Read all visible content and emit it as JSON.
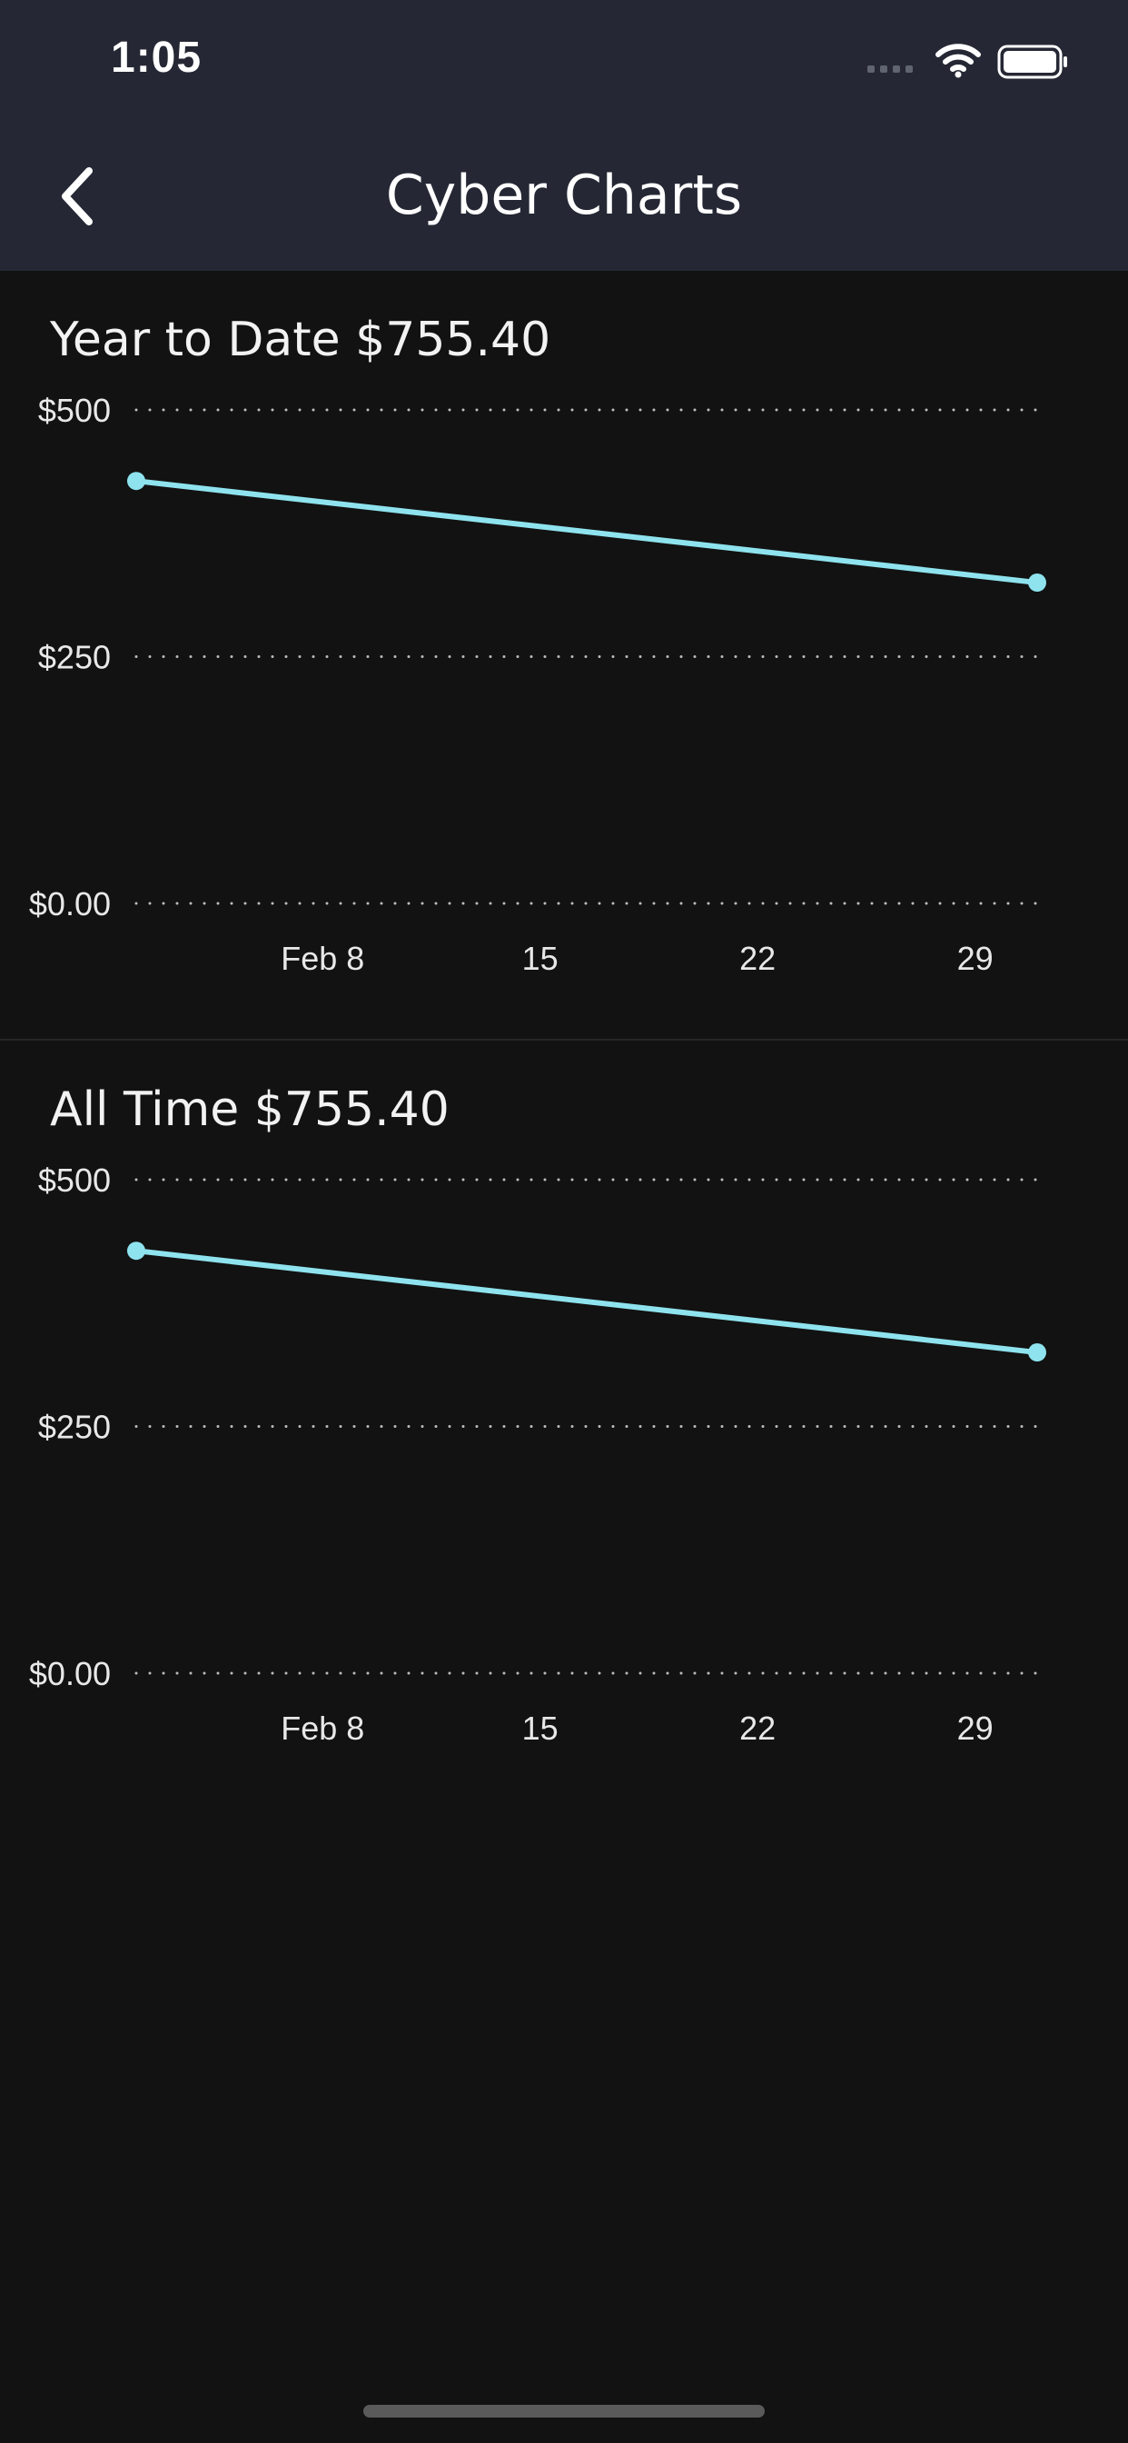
{
  "status_bar": {
    "time": "1:05"
  },
  "nav": {
    "title": "Cyber Charts",
    "back_icon": "chevron-left-icon"
  },
  "colors": {
    "line": "#8ee3ee",
    "background": "#121212",
    "header": "#252834"
  },
  "chart_data": [
    {
      "type": "line",
      "title": "Year to Date $755.40",
      "ylim": [
        0,
        500
      ],
      "yticks": [
        0,
        250,
        500
      ],
      "ytick_labels": [
        "$0.00",
        "$250",
        "$500"
      ],
      "xlim": [
        "2020-02-02",
        "2020-03-02"
      ],
      "xticks": [
        "2020-02-08",
        "2020-02-15",
        "2020-02-22",
        "2020-02-29"
      ],
      "xtick_labels": [
        "Feb 8",
        "15",
        "22",
        "29"
      ],
      "grid": true,
      "series": [
        {
          "x": [
            "2020-02-02",
            "2020-03-02"
          ],
          "values": [
            428,
            325
          ],
          "color": "#8ee3ee"
        }
      ]
    },
    {
      "type": "line",
      "title": "All Time $755.40",
      "ylim": [
        0,
        500
      ],
      "yticks": [
        0,
        250,
        500
      ],
      "ytick_labels": [
        "$0.00",
        "$250",
        "$500"
      ],
      "xlim": [
        "2020-02-02",
        "2020-03-02"
      ],
      "xticks": [
        "2020-02-08",
        "2020-02-15",
        "2020-02-22",
        "2020-02-29"
      ],
      "xtick_labels": [
        "Feb 8",
        "15",
        "22",
        "29"
      ],
      "grid": true,
      "series": [
        {
          "x": [
            "2020-02-02",
            "2020-03-02"
          ],
          "values": [
            428,
            325
          ],
          "color": "#8ee3ee"
        }
      ]
    }
  ]
}
